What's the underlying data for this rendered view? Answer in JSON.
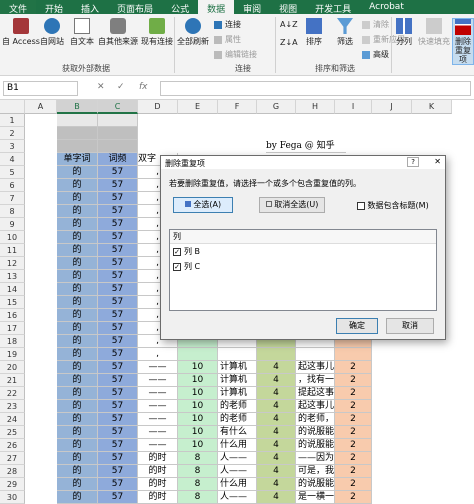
{
  "tabs": [
    "文件",
    "开始",
    "插入",
    "页面布局",
    "公式",
    "数据",
    "审阅",
    "视图",
    "开发工具",
    "Acrobat"
  ],
  "active_tab_index": 5,
  "ribbon": {
    "get_external": [
      "自 Access",
      "自网站",
      "自文本",
      "自其他来源",
      "现有连接"
    ],
    "get_external_group": "获取外部数据",
    "refresh_all": "全部刷新",
    "conn_small": [
      "连接",
      "属性",
      "编辑链接"
    ],
    "conn_group": "连接",
    "sort_az": "A↓Z",
    "sort_za": "Z↓A",
    "sort": "排序",
    "filter": "筛选",
    "sort_small": [
      "清除",
      "重新应用",
      "高级"
    ],
    "sort_group": "排序和筛选",
    "split": "分列",
    "flash_fill": "快速填充",
    "remove_dup": "删除\n重复项"
  },
  "formula_bar": {
    "name_box": "B1",
    "cancel": "✕",
    "enter": "✓",
    "fx": "fx",
    "value": ""
  },
  "columns": [
    "A",
    "B",
    "C",
    "D",
    "E",
    "F",
    "G",
    "H",
    "I",
    "J",
    "K"
  ],
  "sheet": {
    "attribution": "by Fega @ 知乎",
    "header_row": [
      "单字词",
      "词频",
      "双字"
    ],
    "rows": [
      {
        "r": 5,
        "b": "的",
        "c": "57",
        "d": ",",
        "e": "",
        "f": "",
        "g": "",
        "h": "",
        "i": ""
      },
      {
        "r": 6,
        "b": "的",
        "c": "57",
        "d": ",",
        "e": "",
        "f": "",
        "g": "",
        "h": "",
        "i": ""
      },
      {
        "r": 7,
        "b": "的",
        "c": "57",
        "d": ",",
        "e": "",
        "f": "",
        "g": "",
        "h": "",
        "i": ""
      },
      {
        "r": 8,
        "b": "的",
        "c": "57",
        "d": ",",
        "e": "",
        "f": "",
        "g": "",
        "h": "",
        "i": ""
      },
      {
        "r": 9,
        "b": "的",
        "c": "57",
        "d": ",",
        "e": "",
        "f": "",
        "g": "",
        "h": "",
        "i": ""
      },
      {
        "r": 10,
        "b": "的",
        "c": "57",
        "d": ",",
        "e": "",
        "f": "",
        "g": "",
        "h": "",
        "i": ""
      },
      {
        "r": 11,
        "b": "的",
        "c": "57",
        "d": ",",
        "e": "",
        "f": "",
        "g": "",
        "h": "",
        "i": ""
      },
      {
        "r": 12,
        "b": "的",
        "c": "57",
        "d": ",",
        "e": "",
        "f": "",
        "g": "",
        "h": "",
        "i": ""
      },
      {
        "r": 13,
        "b": "的",
        "c": "57",
        "d": ",",
        "e": "",
        "f": "",
        "g": "",
        "h": "",
        "i": ""
      },
      {
        "r": 14,
        "b": "的",
        "c": "57",
        "d": ",",
        "e": "",
        "f": "",
        "g": "",
        "h": "",
        "i": ""
      },
      {
        "r": 15,
        "b": "的",
        "c": "57",
        "d": ",",
        "e": "",
        "f": "",
        "g": "",
        "h": "",
        "i": ""
      },
      {
        "r": 16,
        "b": "的",
        "c": "57",
        "d": ",",
        "e": "",
        "f": "",
        "g": "",
        "h": "",
        "i": ""
      },
      {
        "r": 17,
        "b": "的",
        "c": "57",
        "d": ",",
        "e": "",
        "f": "",
        "g": "",
        "h": "",
        "i": ""
      },
      {
        "r": 18,
        "b": "的",
        "c": "57",
        "d": ",",
        "e": "",
        "f": "",
        "g": "",
        "h": "",
        "i": ""
      },
      {
        "r": 19,
        "b": "的",
        "c": "57",
        "d": ",",
        "e": "",
        "f": "",
        "g": "",
        "h": "",
        "i": ""
      },
      {
        "r": 20,
        "b": "的",
        "c": "57",
        "d": "——",
        "e": "10",
        "f": "计算机",
        "g": "4",
        "h": "起这事儿",
        "i": "2"
      },
      {
        "r": 21,
        "b": "的",
        "c": "57",
        "d": "——",
        "e": "10",
        "f": "计算机",
        "g": "4",
        "h": "，找有一",
        "i": "2"
      },
      {
        "r": 22,
        "b": "的",
        "c": "57",
        "d": "——",
        "e": "10",
        "f": "计算机",
        "g": "4",
        "h": "提起这事",
        "i": "2"
      },
      {
        "r": 23,
        "b": "的",
        "c": "57",
        "d": "——",
        "e": "10",
        "f": "的老师",
        "g": "4",
        "h": "起这事儿",
        "i": "2"
      },
      {
        "r": 24,
        "b": "的",
        "c": "57",
        "d": "——",
        "e": "10",
        "f": "的老师",
        "g": "4",
        "h": "的老师，",
        "i": "2"
      },
      {
        "r": 25,
        "b": "的",
        "c": "57",
        "d": "——",
        "e": "10",
        "f": "有什么",
        "g": "4",
        "h": "的说服能",
        "i": "2"
      },
      {
        "r": 26,
        "b": "的",
        "c": "57",
        "d": "——",
        "e": "10",
        "f": "什么用",
        "g": "4",
        "h": "的说服能",
        "i": "2"
      },
      {
        "r": 27,
        "b": "的",
        "c": "57",
        "d": "的时",
        "e": "8",
        "f": "人——",
        "g": "4",
        "h": "——因为",
        "i": "2"
      },
      {
        "r": 28,
        "b": "的",
        "c": "57",
        "d": "的时",
        "e": "8",
        "f": "人——",
        "g": "4",
        "h": "可是，我",
        "i": "2"
      },
      {
        "r": 29,
        "b": "的",
        "c": "57",
        "d": "的时",
        "e": "8",
        "f": "什么用",
        "g": "4",
        "h": "的说服能",
        "i": "2"
      },
      {
        "r": 30,
        "b": "的",
        "c": "57",
        "d": "的时",
        "e": "8",
        "f": "人——",
        "g": "4",
        "h": "是一横一",
        "i": "2"
      }
    ]
  },
  "dialog": {
    "title": "删除重复项",
    "prompt": "若要删除重复值，请选择一个或多个包含重复值的列。",
    "select_all": "全选(A)",
    "unselect_all": "取消全选(U)",
    "has_headers": "数据包含标题(M)",
    "list_header": "列",
    "columns": [
      {
        "label": "列 B",
        "checked": true
      },
      {
        "label": "列 C",
        "checked": true
      }
    ],
    "ok": "确定",
    "cancel": "取消",
    "help": "?",
    "close": "✕"
  },
  "colors": {
    "excel_green": "#217346",
    "col_b_fill": "#95b3d7",
    "col_c_fill": "#8eaadb",
    "col_e_fill": "#c6efce",
    "col_g_fill": "#c4d79b",
    "col_i_fill": "#f8cbad"
  }
}
